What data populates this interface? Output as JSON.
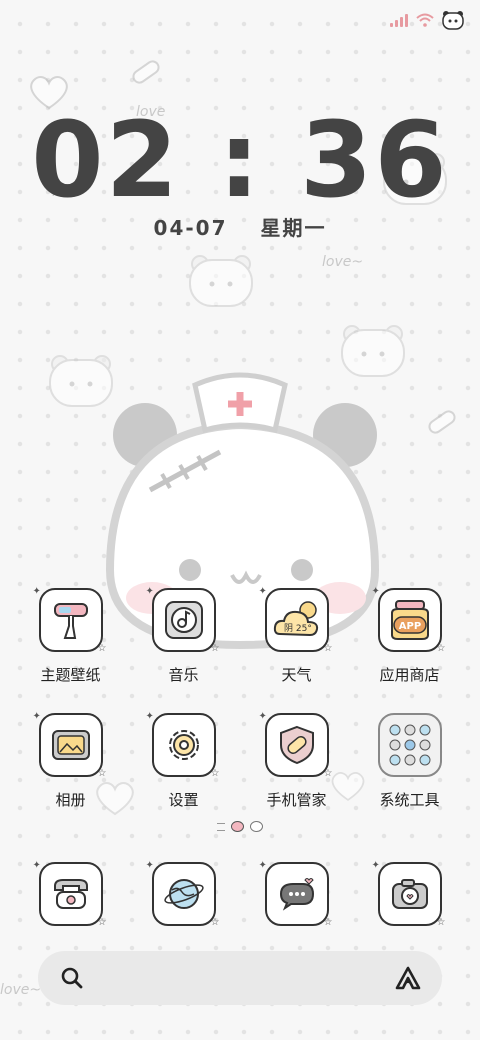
{
  "status_bar": {
    "signal_icon": "signal-bars-icon",
    "wifi_icon": "wifi-icon",
    "battery_icon": "panda-battery-icon"
  },
  "lock_clock": {
    "time": "02 : 36",
    "date": "04-07",
    "weekday": "星期一"
  },
  "home_rows": [
    [
      {
        "label": "主题壁纸",
        "icon": "paintbrush-icon"
      },
      {
        "label": "音乐",
        "icon": "music-record-icon"
      },
      {
        "label": "天气",
        "icon": "weather-cloud-icon",
        "weather_text": "阴 25°"
      },
      {
        "label": "应用商店",
        "icon": "app-store-jar-icon",
        "store_text": "APP"
      }
    ],
    [
      {
        "label": "相册",
        "icon": "photo-frame-icon"
      },
      {
        "label": "设置",
        "icon": "gear-icon"
      },
      {
        "label": "手机管家",
        "icon": "shield-bandage-icon"
      },
      {
        "label": "系统工具",
        "icon": "folder-tools-icon"
      }
    ]
  ],
  "dock": [
    {
      "icon": "phone-icon"
    },
    {
      "icon": "globe-icon"
    },
    {
      "icon": "message-bubble-icon"
    },
    {
      "icon": "camera-icon"
    }
  ],
  "page_indicator": {
    "pages": 2,
    "active": 0
  },
  "search_bar": {
    "search_icon": "search-icon",
    "assistant_icon": "assistant-icon"
  },
  "colors": {
    "background": "#f7f7f7",
    "ink": "#444444",
    "accent_pink": "#f3b7c0",
    "search_bg": "#e9e9e9"
  }
}
